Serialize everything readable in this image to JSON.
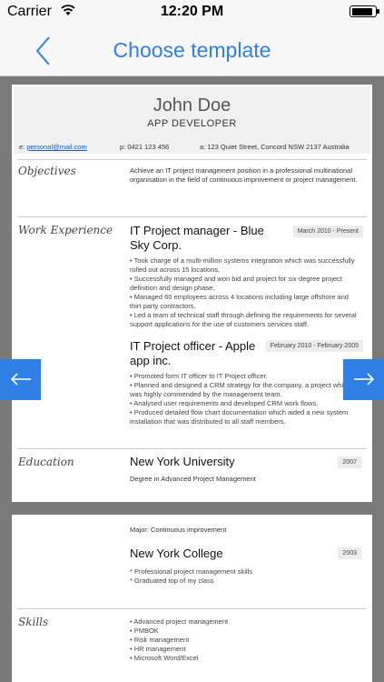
{
  "status_bar": {
    "carrier": "Carrier",
    "time": "12:20 PM",
    "battery_level": 0.9
  },
  "nav": {
    "title": "Choose template",
    "back_icon": "chevron-left-icon"
  },
  "resume": {
    "name": "John Doe",
    "role": "APP DEVELOPER",
    "contact": {
      "email_label": "e: ",
      "email": "personal@mail.com",
      "phone": "p: 0421 123 456",
      "address": "a: 123 Quiet Street, Concord NSW 2137 Australia"
    },
    "objectives": {
      "label": "Objectives",
      "text": "Achieve an IT project management position in a professional multinational organisation in the field of continuous improvement or project management."
    },
    "work": {
      "label": "Work Experience",
      "jobs": [
        {
          "title": "IT Project manager - Blue Sky Corp.",
          "dates": "March 2010 - Present",
          "bullets": [
            "• Took charge of a multi-million systems integration which was successfully rolled out across 15 locations.",
            "• Successfully managed and won bid and project for six-degree project definition and design phase.",
            "• Managed 60 employees across 4 locations including large offshore and thirt party contractors.",
            "• Led a team of technical staff through defining the requirements for several support applications for the use of customers services staff."
          ]
        },
        {
          "title": "IT Project officer - Apple app inc.",
          "dates": "February 2010 - February 2005",
          "bullets": [
            "• Promoted form IT officer to IT Project officer.",
            "• Planned and designed a CRM strategy for the company, a project which was highly commended by the management team.",
            "• Analysed user requirements and developed CRM work flows.",
            "• Produced detailed flow chart documentation which aided a new system installation that was distributed to all staff members."
          ]
        }
      ]
    },
    "education": {
      "label": "Education",
      "schools": [
        {
          "name": "New York University",
          "year": "2007",
          "detail": "Degree in Advanced Project Management"
        },
        {
          "name": "New York College",
          "year": "2003",
          "major": "Major: Continuous improvement",
          "bullets": [
            "* Professional project management skills",
            "* Graduated top of my class"
          ]
        }
      ]
    },
    "skills": {
      "label": "Skills",
      "items": [
        "• Advanced project management",
        "• PMBOK",
        "• Risk management",
        "• HR management",
        "• Microsoft Word/Excel"
      ]
    }
  },
  "paging": {
    "prev_icon": "arrow-left-icon",
    "next_icon": "arrow-right-icon"
  },
  "colors": {
    "accent": "#2f7fe4",
    "background": "#7a7a7a",
    "header_band": "#f0f0f0"
  }
}
